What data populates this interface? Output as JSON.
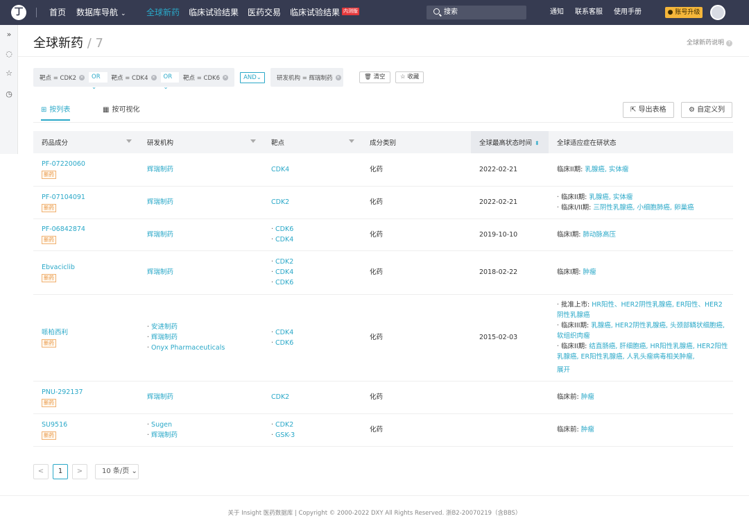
{
  "nav": {
    "logo": "丁",
    "items": [
      {
        "label": "首页"
      },
      {
        "label": "数据库导航"
      },
      {
        "label": "全球新药"
      },
      {
        "label": "临床试验结果"
      },
      {
        "label": "医药交易"
      },
      {
        "label": "临床试验结果"
      }
    ],
    "beta_badge": "内测版",
    "search_placeholder": "搜索",
    "links": {
      "notify": "通知",
      "service": "联系客服",
      "manual": "使用手册"
    },
    "upgrade": "账号升级",
    "accent": "#2aa8c8",
    "bg": "#363b51"
  },
  "page": {
    "title": "全球新药",
    "count_sep": " / ",
    "count": "7",
    "help": "全球新药说明"
  },
  "filters": {
    "tag1": "靶点 = CDK2",
    "or1": "OR",
    "tag2": "靶点 = CDK4",
    "or2": "OR",
    "tag3": "靶点 = CDK6",
    "and": "AND",
    "tag4": "研发机构 = 辉瑞制药",
    "clear": "清空",
    "collect": "收藏"
  },
  "tabs": {
    "list": "按列表",
    "visual": "按可视化",
    "export": "导出表格",
    "custom": "自定义列"
  },
  "table": {
    "headers": [
      "药品成分",
      "研发机构",
      "靶点",
      "成分类别",
      "全球最高状态时间",
      "全球适应症在研状态"
    ],
    "new_tag": "新药",
    "rows": [
      {
        "name": "PF-07220060",
        "org": [
          "辉瑞制药"
        ],
        "target": [
          "CDK4"
        ],
        "category": "化药",
        "date": "2022-02-21",
        "status": [
          {
            "stage": "临床II期: ",
            "inds": "乳腺癌, 实体瘤"
          }
        ]
      },
      {
        "name": "PF-07104091",
        "org": [
          "辉瑞制药"
        ],
        "target": [
          "CDK2"
        ],
        "category": "化药",
        "date": "2022-02-21",
        "status": [
          {
            "stage": "临床II期: ",
            "inds": "乳腺癌, 实体瘤"
          },
          {
            "stage": "临床I/II期: ",
            "inds": "三阴性乳腺癌, 小细胞肺癌, 卵巢癌"
          }
        ]
      },
      {
        "name": "PF-06842874",
        "org": [
          "辉瑞制药"
        ],
        "target": [
          "CDK6",
          "CDK4"
        ],
        "category": "化药",
        "date": "2019-10-10",
        "status": [
          {
            "stage": "临床I期: ",
            "inds": "肺动脉高压"
          }
        ]
      },
      {
        "name": "Ebvaciclib",
        "org": [
          "辉瑞制药"
        ],
        "target": [
          "CDK2",
          "CDK4",
          "CDK6"
        ],
        "category": "化药",
        "date": "2018-02-22",
        "status": [
          {
            "stage": "临床I期: ",
            "inds": "肿瘤"
          }
        ]
      },
      {
        "name": "哌柏西利",
        "org": [
          "安进制药",
          "辉瑞制药",
          "Onyx Pharmaceuticals"
        ],
        "target": [
          "CDK4",
          "CDK6"
        ],
        "category": "化药",
        "date": "2015-02-03",
        "status": [
          {
            "stage": "批准上市: ",
            "inds": "HR阳性、HER2阴性乳腺癌, ER阳性、HER2阴性乳腺癌"
          },
          {
            "stage": "临床III期: ",
            "inds": "乳腺癌, HER2阴性乳腺癌, 头颈部鳞状细胞癌, 软组织肉瘤"
          },
          {
            "stage": "临床II期: ",
            "inds": "结直肠癌, 肝细胞癌, HR阳性乳腺癌, HER2阳性乳腺癌, ER阳性乳腺癌, 人乳头瘤病毒相关肿瘤,"
          }
        ],
        "expand": "展开"
      },
      {
        "name": "PNU-292137",
        "org": [
          "辉瑞制药"
        ],
        "target": [
          "CDK2"
        ],
        "category": "化药",
        "date": "",
        "status": [
          {
            "stage": "临床前: ",
            "inds": "肿瘤"
          }
        ]
      },
      {
        "name": "SU9516",
        "org": [
          "Sugen",
          "辉瑞制药"
        ],
        "target": [
          "CDK2",
          "GSK-3"
        ],
        "category": "化药",
        "date": "",
        "status": [
          {
            "stage": "临床前: ",
            "inds": "肿瘤"
          }
        ]
      }
    ]
  },
  "pagination": {
    "prev": "<",
    "current": "1",
    "next": ">",
    "page_size": "10 条/页"
  },
  "footer": "关于 Insight 医药数据库 | Copyright © 2000-2022 DXY All Rights Reserved. 浙B2-20070219（含BBS）"
}
